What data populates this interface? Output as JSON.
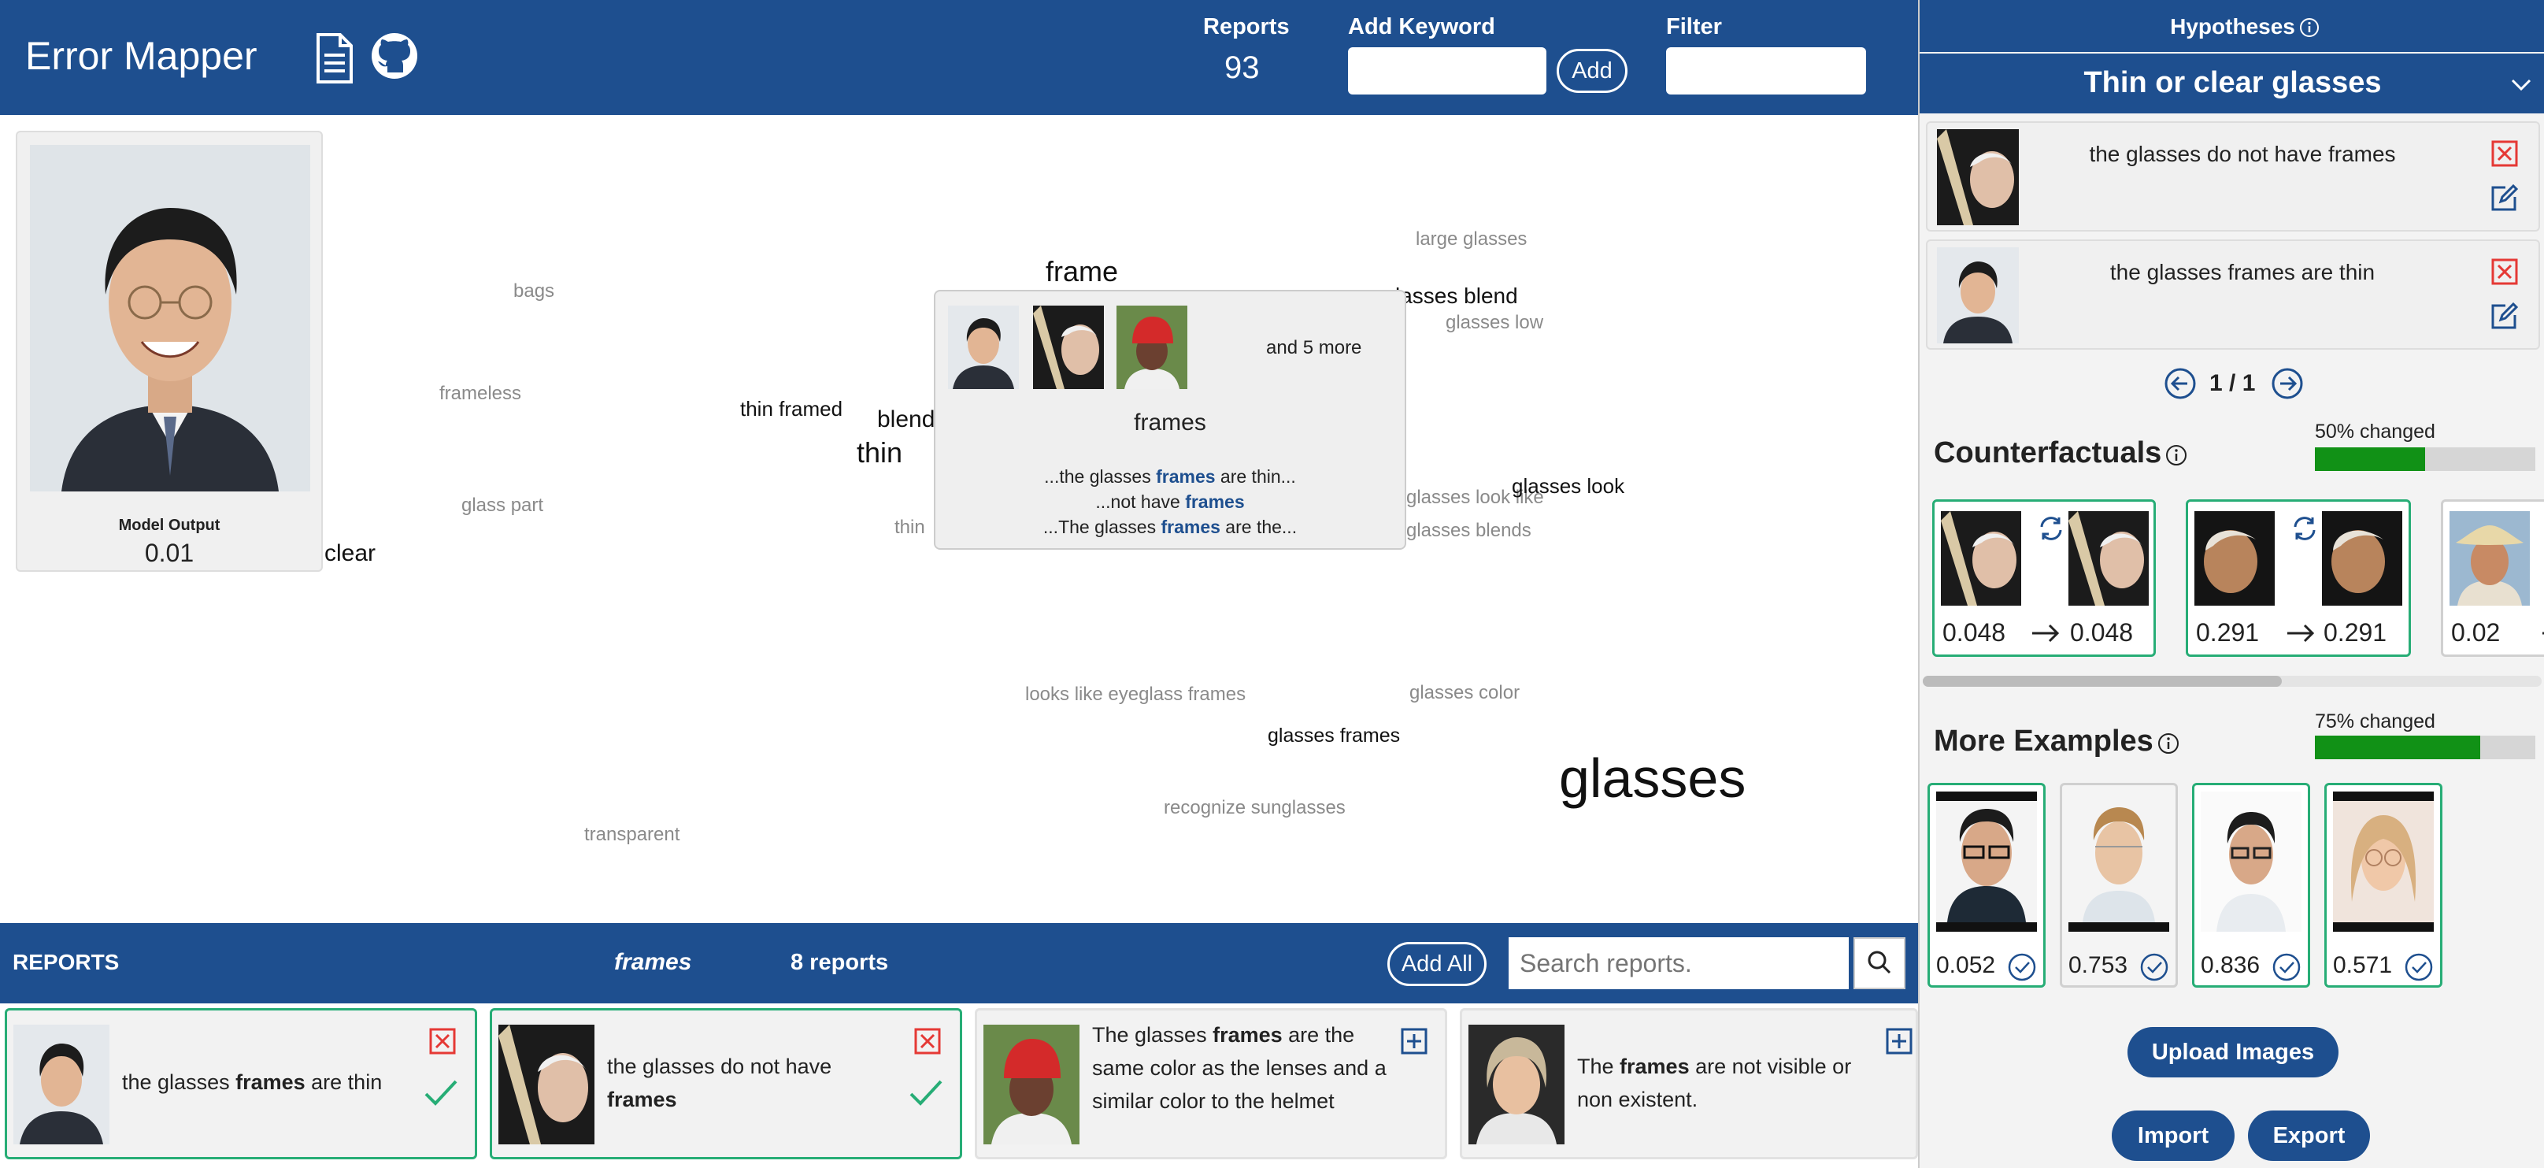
{
  "header": {
    "title": "Error Mapper",
    "doc_icon": "document-icon",
    "github_icon": "github-icon",
    "reports_label": "Reports",
    "reports_count": "93",
    "add_keyword_label": "Add Keyword",
    "add_keyword_value": "",
    "add_button": "Add",
    "filter_label": "Filter",
    "filter_value": ""
  },
  "model": {
    "label": "Model Output",
    "value": "0.01"
  },
  "cloud_words": [
    {
      "text": "bags",
      "dark": false
    },
    {
      "text": "frameless",
      "dark": false
    },
    {
      "text": "thin framed",
      "dark": true
    },
    {
      "text": "blend",
      "dark": true
    },
    {
      "text": "thin",
      "dark": true
    },
    {
      "text": "thin",
      "dark": false
    },
    {
      "text": "glass part",
      "dark": false
    },
    {
      "text": "clear",
      "dark": true
    },
    {
      "text": "frame",
      "dark": true
    },
    {
      "text": "large glasses",
      "dark": false
    },
    {
      "text": "lasses blend",
      "dark": true
    },
    {
      "text": "glasses low",
      "dark": false
    },
    {
      "text": "glasses look like",
      "dark": false
    },
    {
      "text": "glasses look",
      "dark": true
    },
    {
      "text": "glasses blends",
      "dark": false
    },
    {
      "text": "looks like eyeglass frames",
      "dark": false
    },
    {
      "text": "glasses color",
      "dark": false
    },
    {
      "text": "glasses frames",
      "dark": true
    },
    {
      "text": "glasses",
      "dark": true
    },
    {
      "text": "recognize sunglasses",
      "dark": false
    },
    {
      "text": "transparent",
      "dark": false
    }
  ],
  "popup": {
    "more": "and 5 more",
    "keyword": "frames",
    "snippets": [
      {
        "pre": "...the glasses ",
        "kw": "frames",
        "post": " are thin..."
      },
      {
        "pre": "...not have ",
        "kw": "frames",
        "post": ""
      },
      {
        "pre": "...The glasses ",
        "kw": "frames",
        "post": " are the..."
      }
    ]
  },
  "reports_bar": {
    "title": "REPORTS",
    "keyword": "frames",
    "count": "8 reports",
    "add_all": "Add All",
    "search_placeholder": "Search reports."
  },
  "report_cards": [
    {
      "pre": "the glasses ",
      "kw": "frames",
      "post": " are thin",
      "accepted": true
    },
    {
      "pre": "the glasses do not have ",
      "kw": "frames",
      "post": "",
      "accepted": true
    },
    {
      "pre": "The glasses ",
      "kw": "frames",
      "post": " are the same color as the lenses and a similar color to the helmet",
      "accepted": false
    },
    {
      "pre": "The ",
      "kw": "frames",
      "post": " are not visible or non existent.",
      "accepted": false
    }
  ],
  "hypotheses": {
    "label": "Hypotheses",
    "selected": "Thin or clear glasses",
    "items": [
      {
        "text": "the glasses do not have frames"
      },
      {
        "text": "the glasses frames are thin"
      }
    ],
    "pager": "1 / 1"
  },
  "counterfactuals": {
    "title": "Counterfactuals",
    "changed_label": "50% changed",
    "changed_fraction": 0.5,
    "pairs": [
      {
        "before": "0.048",
        "after": "0.048"
      },
      {
        "before": "0.291",
        "after": "0.291"
      },
      {
        "before": "0.02",
        "after": ""
      }
    ]
  },
  "more_examples": {
    "title": "More Examples",
    "changed_label": "75% changed",
    "changed_fraction": 0.75,
    "items": [
      {
        "value": "0.052",
        "highlighted": true
      },
      {
        "value": "0.753",
        "highlighted": false
      },
      {
        "value": "0.836",
        "highlighted": true
      },
      {
        "value": "0.571",
        "highlighted": true
      }
    ]
  },
  "buttons": {
    "upload": "Upload Images",
    "import": "Import",
    "export": "Export"
  },
  "colors": {
    "brand_blue": "#1e4f8f",
    "accept_green": "#27ad76",
    "progress_green": "#119116",
    "reject_red": "#e53935"
  }
}
